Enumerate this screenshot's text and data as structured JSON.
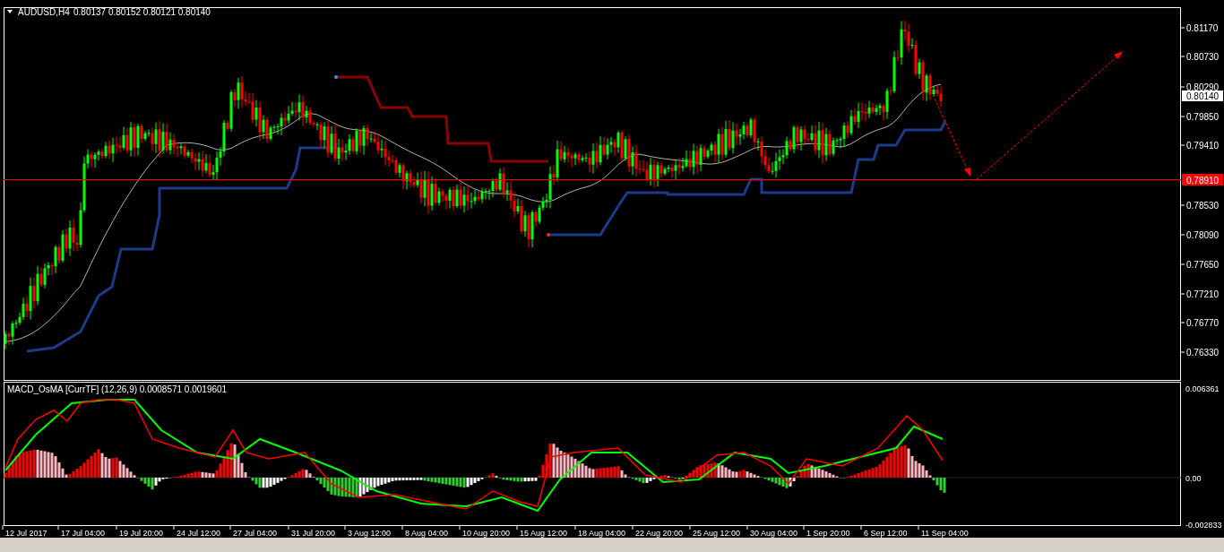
{
  "header": {
    "symbol": "AUDUSD,H4",
    "quote": "0.80137 0.80152 0.80121 0.80140"
  },
  "price_axis": {
    "labels": [
      "0.81170",
      "0.80730",
      "0.80290",
      "0.79850",
      "0.79410",
      "0.78530",
      "0.78090",
      "0.77650",
      "0.77210",
      "0.76770",
      "0.76330"
    ],
    "current_price": "0.80140",
    "line_price": "0.78910"
  },
  "indicator": {
    "title": "MACD_OsMA [CurrTF] (12,26,9) 0.0008571 0.0019601",
    "axis_labels": [
      "0.006361",
      "0.00",
      "-0.002833"
    ]
  },
  "time_axis": [
    "12 Jul 2017",
    "17 Jul 04:00",
    "19 Jul 20:00",
    "24 Jul 12:00",
    "27 Jul 04:00",
    "31 Jul 20:00",
    "3 Aug 12:00",
    "8 Aug 04:00",
    "10 Aug 20:00",
    "15 Aug 12:00",
    "18 Aug 04:00",
    "22 Aug 20:00",
    "25 Aug 12:00",
    "30 Aug 04:00",
    "1 Sep 20:00",
    "6 Sep 12:00",
    "11 Sep 04:00"
  ]
}
